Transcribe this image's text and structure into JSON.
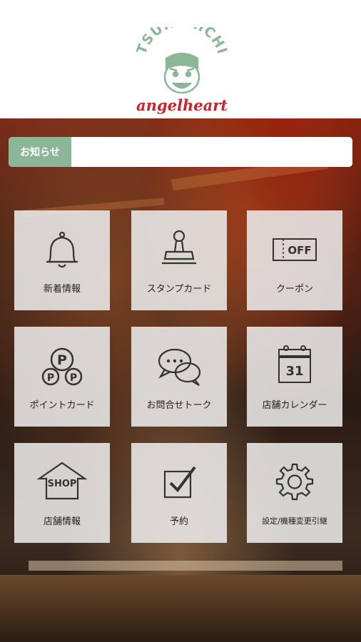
{
  "brand": {
    "name": "TSURUKICHI",
    "sub": "angelheart",
    "colors": {
      "green": "#8cb698",
      "red": "#c8242b"
    }
  },
  "notice": {
    "label": "お知らせ",
    "text": ""
  },
  "menu": [
    {
      "label": "新着情報",
      "icon": "bell-icon"
    },
    {
      "label": "スタンプカード",
      "icon": "stamp-icon"
    },
    {
      "label": "クーポン",
      "icon": "coupon-icon",
      "icon_text": "OFF"
    },
    {
      "label": "ポイントカード",
      "icon": "point-card-icon",
      "icon_text": "P"
    },
    {
      "label": "お問合せトーク",
      "icon": "chat-icon"
    },
    {
      "label": "店舗カレンダー",
      "icon": "calendar-icon",
      "icon_text": "31"
    },
    {
      "label": "店舗情報",
      "icon": "shop-icon",
      "icon_text": "SHOP"
    },
    {
      "label": "予約",
      "icon": "checkbox-icon"
    },
    {
      "label": "設定/機種変更引継",
      "icon": "gear-icon"
    }
  ]
}
